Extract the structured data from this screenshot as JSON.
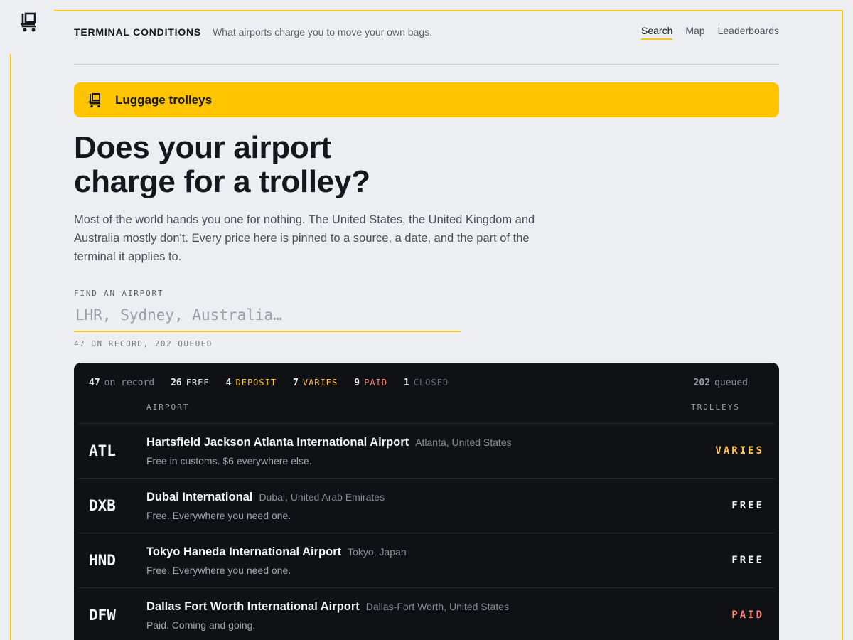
{
  "brand": "TERMINAL CONDITIONS",
  "tagline": "What airports charge you to move your own bags.",
  "nav": [
    {
      "label": "Search",
      "active": true
    },
    {
      "label": "Map",
      "active": false
    },
    {
      "label": "Leaderboards",
      "active": false
    }
  ],
  "banner": {
    "icon": "trolley-icon",
    "label": "Luggage trolleys"
  },
  "headline": {
    "line1": "Does your airport",
    "line2": "charge for a trolley?"
  },
  "intro": "Most of the world hands you one for nothing. The United States, the United Kingdom and Australia mostly don't. Every price here is pinned to a source, a date, and the part of the terminal it applies to.",
  "search": {
    "label": "FIND AN AIRPORT",
    "placeholder": "LHR, Sydney, Australia…",
    "value": ""
  },
  "record_note": "47 ON RECORD, 202 QUEUED",
  "colors": {
    "accent": "#ffc400",
    "frame": "#f5c518",
    "panel": "#0f1115",
    "varies": "#ffc24a",
    "paid": "#ff8a7a"
  },
  "stats": {
    "on_record": {
      "count": "47",
      "label": "on record"
    },
    "free": {
      "count": "26",
      "label": "FREE"
    },
    "deposit": {
      "count": "4",
      "label": "DEPOSIT"
    },
    "varies": {
      "count": "7",
      "label": "VARIES"
    },
    "paid": {
      "count": "9",
      "label": "PAID"
    },
    "closed": {
      "count": "1",
      "label": "CLOSED"
    },
    "queued": {
      "count": "202",
      "label": "queued"
    }
  },
  "table": {
    "headers": {
      "airport": "AIRPORT",
      "trolleys": "TROLLEYS"
    },
    "rows": [
      {
        "code": "ATL",
        "name": "Hartsfield Jackson Atlanta International Airport",
        "location": "Atlanta, United States",
        "note": "Free in customs. $6 everywhere else.",
        "status": "VARIES"
      },
      {
        "code": "DXB",
        "name": "Dubai International",
        "location": "Dubai, United Arab Emirates",
        "note": "Free. Everywhere you need one.",
        "status": "FREE"
      },
      {
        "code": "HND",
        "name": "Tokyo Haneda International Airport",
        "location": "Tokyo, Japan",
        "note": "Free. Everywhere you need one.",
        "status": "FREE"
      },
      {
        "code": "DFW",
        "name": "Dallas Fort Worth International Airport",
        "location": "Dallas-Fort Worth, United States",
        "note": "Paid. Coming and going.",
        "status": "PAID"
      }
    ]
  }
}
